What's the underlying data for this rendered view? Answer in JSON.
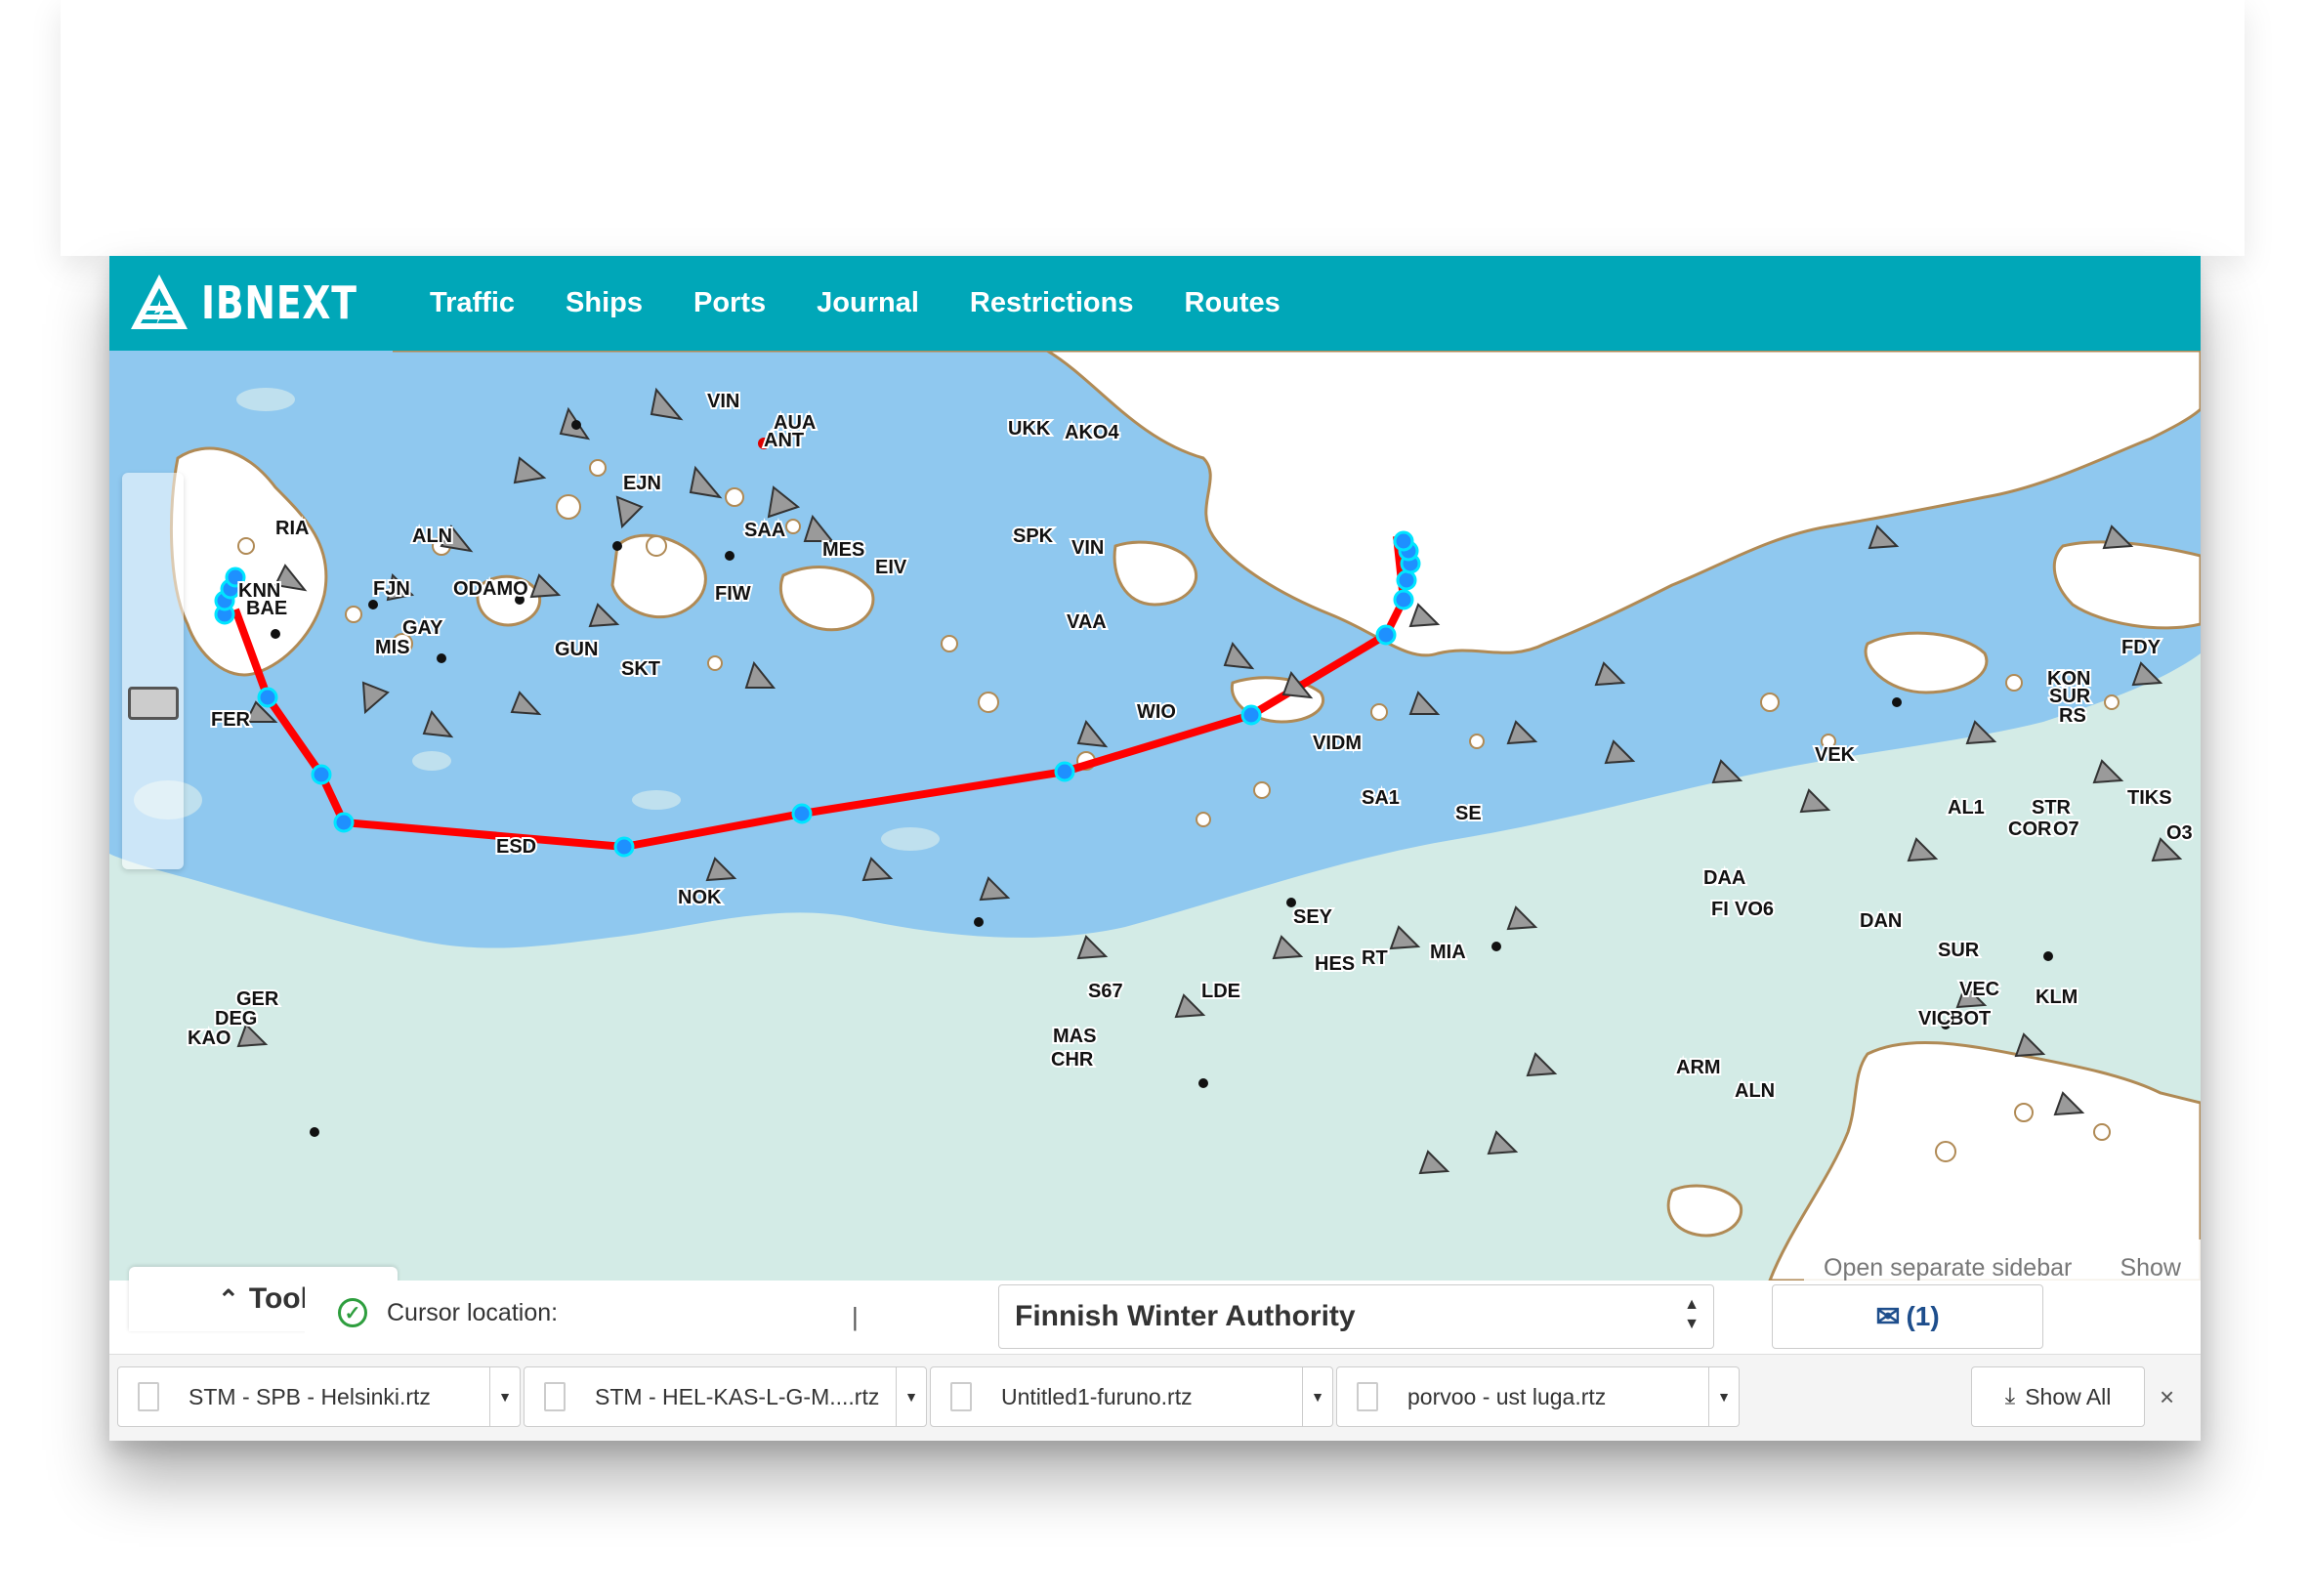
{
  "brand": {
    "name": "IBNEXT"
  },
  "nav": {
    "items": [
      {
        "label": "Traffic"
      },
      {
        "label": "Ships"
      },
      {
        "label": "Ports"
      },
      {
        "label": "Journal"
      },
      {
        "label": "Restrictions"
      },
      {
        "label": "Routes"
      }
    ]
  },
  "map": {
    "ship_labels": [
      "VIN",
      "AUA",
      "ANT",
      "UKK",
      "AKO4",
      "EJN",
      "RIA",
      "ALN",
      "SAA",
      "MES",
      "SPK",
      "VIN",
      "EIV",
      "KNN",
      "BAE",
      "FJN",
      "ODAMO",
      "FIW",
      "GAY",
      "MIS",
      "GUN",
      "SKT",
      "VAA",
      "FER",
      "WIO",
      "VIDM",
      "SA1",
      "SE",
      "ESD",
      "NOK",
      "SEY",
      "HES",
      "RT",
      "MIA",
      "S67",
      "LDE",
      "MAS",
      "CHR",
      "GER",
      "DEG",
      "KAO",
      "ARM",
      "ALN",
      "DAA",
      "FI",
      "VO6",
      "VEK",
      "AL1",
      "COR",
      "O7",
      "TIKS",
      "O3",
      "DAN",
      "SUR",
      "VEC",
      "KLM",
      "BOT",
      "VIC",
      "FDY",
      "KON",
      "SUR",
      "RS",
      "STR"
    ],
    "colors": {
      "route": "#ff0000",
      "waypoint": "#1e90ff",
      "deep_water": "#8fc8ef",
      "shallow": "#d3ebe6",
      "land": "#ffffff",
      "contour": "#b08a55"
    },
    "open_sidebar": {
      "label": "Open separate sidebar",
      "action": "Show"
    }
  },
  "toolbar": {
    "tool_label": "Tool"
  },
  "status": {
    "cursor_label": "Cursor location:",
    "authority": "Finnish Winter Authority",
    "messages": "(1)"
  },
  "files": {
    "tabs": [
      {
        "label": "STM - SPB - Helsinki.rtz"
      },
      {
        "label": "STM - HEL-KAS-L-G-M....rtz"
      },
      {
        "label": "Untitled1-furuno.rtz"
      },
      {
        "label": "porvoo - ust luga.rtz"
      }
    ],
    "show_all": "Show All",
    "close": "×"
  }
}
